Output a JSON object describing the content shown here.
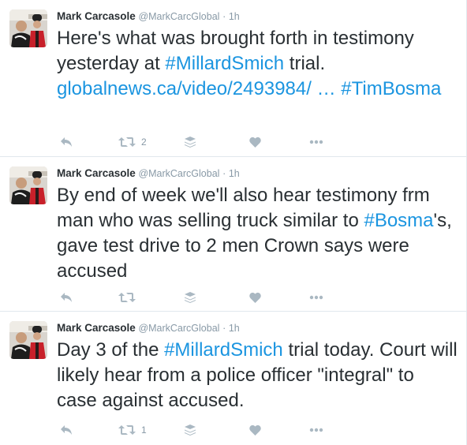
{
  "tweets": [
    {
      "fullname": "Mark Carcasole",
      "username": "@MarkCarcGlobal",
      "dot": "·",
      "time": "1h",
      "segments": [
        {
          "text": "Here's what was brought forth in testimony yesterday at ",
          "link": false
        },
        {
          "text": "#MillardSmich",
          "link": true
        },
        {
          "text": " trial. ",
          "link": false
        },
        {
          "text": "globalnews.ca/video/2493984/  …",
          "link": true
        },
        {
          "text": " ",
          "link": false
        },
        {
          "text": "#TimBosma",
          "link": true
        }
      ],
      "retweet_count": "2",
      "like_count": ""
    },
    {
      "fullname": "Mark Carcasole",
      "username": "@MarkCarcGlobal",
      "dot": "·",
      "time": "1h",
      "segments": [
        {
          "text": "By end of week we'll also hear testimony frm man who was selling truck similar to ",
          "link": false
        },
        {
          "text": "#Bosma",
          "link": true
        },
        {
          "text": "'s, gave test drive to 2 men Crown says were accused",
          "link": false
        }
      ],
      "retweet_count": "",
      "like_count": ""
    },
    {
      "fullname": "Mark Carcasole",
      "username": "@MarkCarcGlobal",
      "dot": "·",
      "time": "1h",
      "segments": [
        {
          "text": "Day 3 of the ",
          "link": false
        },
        {
          "text": "#MillardSmich",
          "link": true
        },
        {
          "text": " trial today. Court will likely hear from a police officer \"integral\" to case against accused.",
          "link": false
        }
      ],
      "retweet_count": "1",
      "like_count": ""
    }
  ],
  "icons": {
    "reply": "reply-icon",
    "retweet": "retweet-icon",
    "buffer": "buffer-stack-icon",
    "like": "heart-icon",
    "more": "more-dots-icon"
  },
  "colors": {
    "link": "#1b95e0",
    "text": "#292f33",
    "muted": "#8899a6",
    "icon": "#aab8c2",
    "divider": "#e1e8ed"
  }
}
